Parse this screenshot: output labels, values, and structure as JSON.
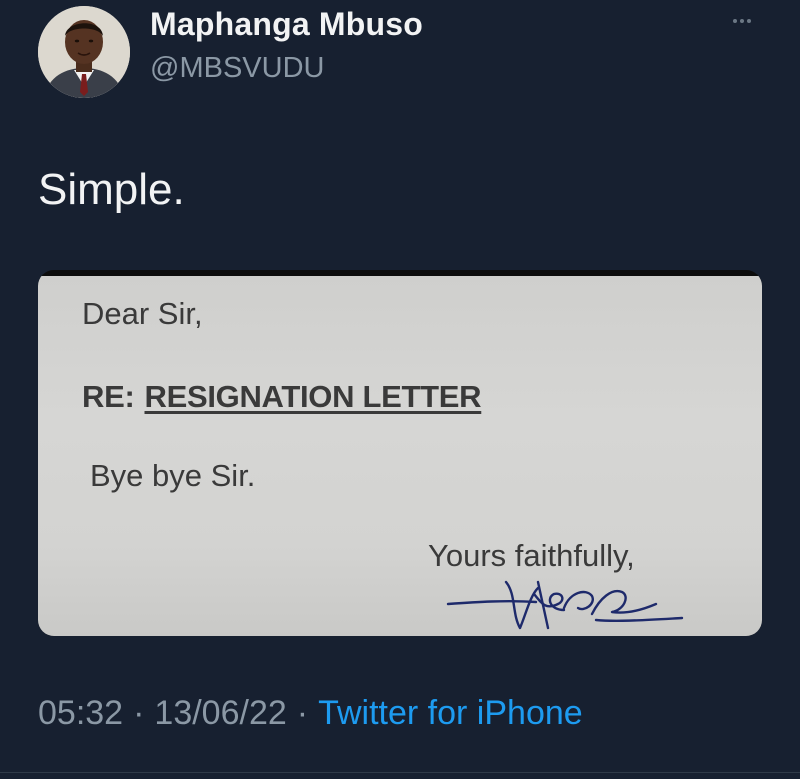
{
  "author": {
    "display_name": "Maphanga Mbuso",
    "handle": "@MBSVUDU"
  },
  "tweet": {
    "text": "Simple."
  },
  "media": {
    "salutation": "Dear Sir,",
    "re_label": "RE:",
    "re_subject": "RESIGNATION LETTER",
    "body": "Bye bye Sir.",
    "signoff": "Yours faithfully,"
  },
  "meta": {
    "time": "05:32",
    "date": "13/06/22",
    "separator": "·",
    "source": "Twitter for iPhone"
  },
  "colors": {
    "background": "#172030",
    "link": "#1d9bf0",
    "secondary_text": "#8b98a5",
    "signature_ink": "#1e2a6b"
  },
  "icons": {
    "more": "more-horizontal-icon",
    "avatar": "profile-photo"
  }
}
